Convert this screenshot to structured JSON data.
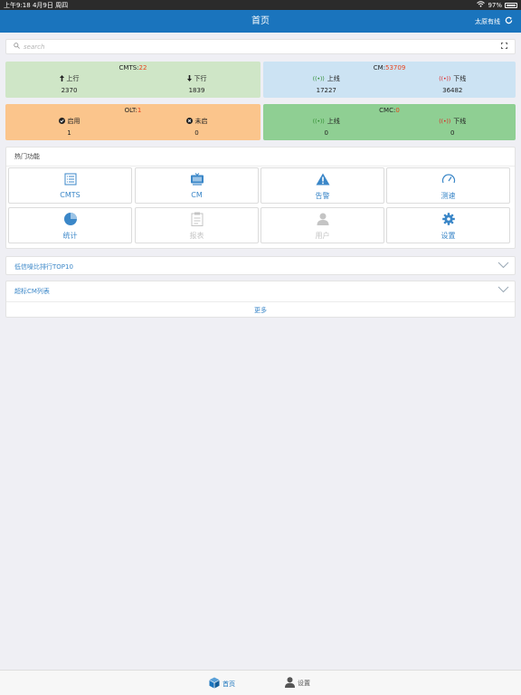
{
  "status_bar": {
    "time_date": "上午9:18  4月9日 周四",
    "battery": "97%"
  },
  "nav": {
    "title": "首页",
    "action_label": "太原有线"
  },
  "search": {
    "placeholder": "search"
  },
  "stats": {
    "cmts": {
      "label": "CMTS:",
      "count": "22",
      "left_label": "上行",
      "left_value": "2370",
      "right_label": "下行",
      "right_value": "1839"
    },
    "cm": {
      "label": "CM:",
      "count": "53709",
      "left_label": "上线",
      "left_value": "17227",
      "right_label": "下线",
      "right_value": "36482"
    },
    "olt": {
      "label": "OLT:",
      "count": "1",
      "left_label": "启用",
      "left_value": "1",
      "right_label": "未启",
      "right_value": "0"
    },
    "cmc": {
      "label": "CMC:",
      "count": "0",
      "left_label": "上线",
      "left_value": "0",
      "right_label": "下线",
      "right_value": "0"
    }
  },
  "hot": {
    "title": "热门功能",
    "tiles": [
      {
        "label": "CMTS",
        "icon": "list-icon"
      },
      {
        "label": "CM",
        "icon": "monitor-icon"
      },
      {
        "label": "告警",
        "icon": "warning-icon"
      },
      {
        "label": "测速",
        "icon": "speedometer-icon"
      },
      {
        "label": "统计",
        "icon": "pie-chart-icon"
      },
      {
        "label": "报表",
        "icon": "clipboard-icon"
      },
      {
        "label": "用户",
        "icon": "user-icon"
      },
      {
        "label": "设置",
        "icon": "gear-icon"
      }
    ]
  },
  "panels": {
    "snr": {
      "title": "低信噪比排行TOP10"
    },
    "exceed": {
      "title": "超标CM列表",
      "more": "更多"
    }
  },
  "tabbar": {
    "home": "首页",
    "settings": "设置"
  },
  "colors": {
    "primary": "#1a74bd",
    "accent_red": "#e8431c"
  }
}
